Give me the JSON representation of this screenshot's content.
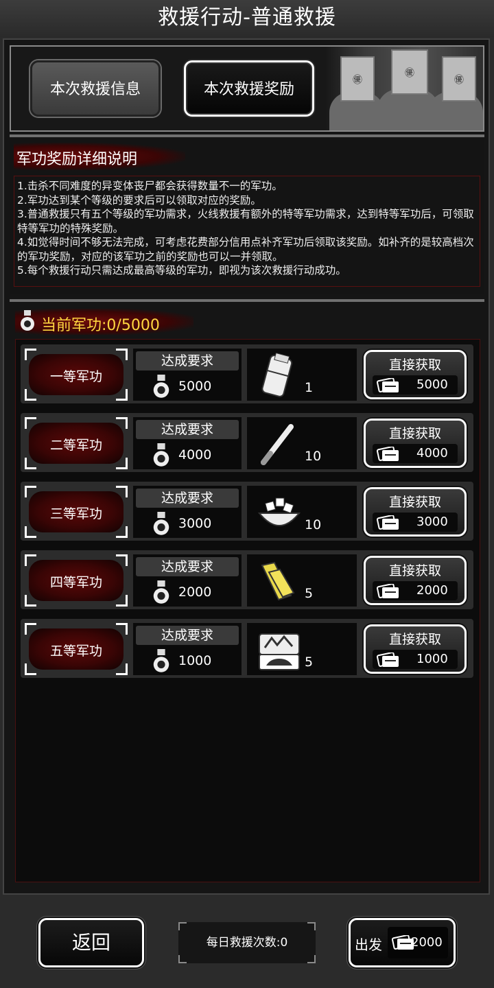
{
  "title": "救援行动-普通救援",
  "tabs": {
    "info": "本次救援信息",
    "reward": "本次救援奖励"
  },
  "art": {
    "mask_symbol": "㊝"
  },
  "description": {
    "heading": "军功奖励详细说明",
    "lines": [
      "1.击杀不同难度的异变体丧尸都会获得数量不一的军功。",
      "2.军功达到某个等级的要求后可以领取对应的奖励。",
      "3.普通救援只有五个等级的军功需求，火线救援有额外的特等军功需求，达到特等军功后，可领取特等军功的特殊奖励。",
      "4.如觉得时间不够无法完成，可考虑花费部分信用点补齐军功后领取该奖励。如补齐的是较高档次的军功奖励，对应的该军功之前的奖励也可以一并领取。",
      "5.每个救援行动只需达成最高等级的军功，即视为该次救援行动成功。"
    ]
  },
  "merit": {
    "current": "当前军功:0/5000"
  },
  "tiers": [
    {
      "rank": "一等军功",
      "req_label": "达成要求",
      "req": "5000",
      "item": "armor-vest-icon",
      "qty": "1",
      "buy_label": "直接获取",
      "price": "5000"
    },
    {
      "rank": "二等军功",
      "req_label": "达成要求",
      "req": "4000",
      "item": "bat-icon",
      "qty": "10",
      "buy_label": "直接获取",
      "price": "4000"
    },
    {
      "rank": "三等军功",
      "req_label": "达成要求",
      "req": "3000",
      "item": "food-bowl-icon",
      "qty": "10",
      "buy_label": "直接获取",
      "price": "3000"
    },
    {
      "rank": "四等军功",
      "req_label": "达成要求",
      "req": "2000",
      "item": "cloth-icon",
      "qty": "5",
      "buy_label": "直接获取",
      "price": "2000"
    },
    {
      "rank": "五等军功",
      "req_label": "达成要求",
      "req": "1000",
      "item": "car-parts-icon",
      "qty": "5",
      "buy_label": "直接获取",
      "price": "1000"
    }
  ],
  "footer": {
    "back": "返回",
    "daily": "每日救援次数:0",
    "go": "出发",
    "go_cost": "2000"
  }
}
